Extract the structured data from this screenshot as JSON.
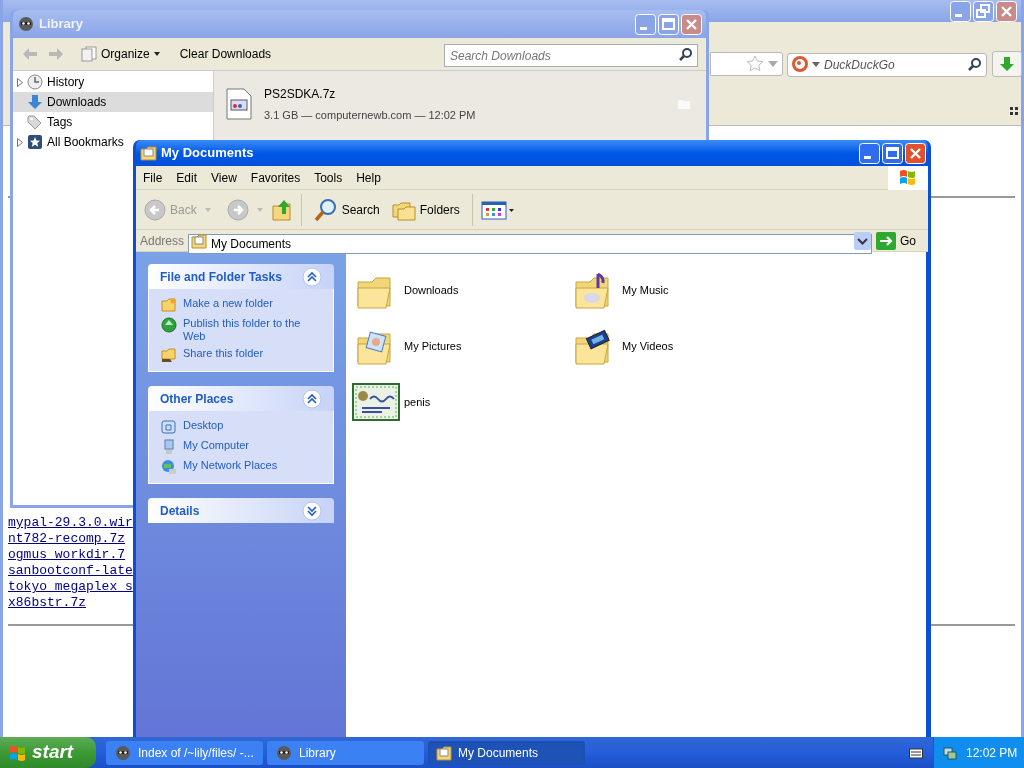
{
  "browser": {
    "search": {
      "placeholder": "DuckDuckGo"
    },
    "links": [
      "mypal-29.3.0.wir",
      "nt782-recomp.7z",
      "ogmus workdir.7",
      "sanbootconf-late",
      "tokyo megaplex s",
      "x86bstr.7z"
    ]
  },
  "library": {
    "title": "Library",
    "toolbar": {
      "organize": "Organize",
      "clear": "Clear Downloads",
      "search": {
        "placeholder": "Search Downloads"
      }
    },
    "sidebar": [
      {
        "label": "History",
        "kind": "history",
        "expandable": true,
        "selected": false
      },
      {
        "label": "Downloads",
        "kind": "downloads",
        "expandable": false,
        "selected": true
      },
      {
        "label": "Tags",
        "kind": "tags",
        "expandable": false,
        "selected": false
      },
      {
        "label": "All Bookmarks",
        "kind": "bookmarks",
        "expandable": true,
        "selected": false
      }
    ],
    "downloads": [
      {
        "name": "PS2SDKA.7z",
        "details": "3.1 GB — computernewb.com — 12:02 PM"
      }
    ]
  },
  "explorer": {
    "title": "My Documents",
    "menu": [
      "File",
      "Edit",
      "View",
      "Favorites",
      "Tools",
      "Help"
    ],
    "toolbar": {
      "back": "Back",
      "search": "Search",
      "folders": "Folders"
    },
    "address": {
      "label": "Address",
      "value": "My Documents",
      "go": "Go"
    },
    "panels": [
      {
        "title": "File and Folder Tasks",
        "expanded": true,
        "items": [
          {
            "label": "Make a new folder",
            "kind": "new-folder"
          },
          {
            "label": "Publish this folder to the Web",
            "kind": "publish"
          },
          {
            "label": "Share this folder",
            "kind": "share"
          }
        ]
      },
      {
        "title": "Other Places",
        "expanded": true,
        "items": [
          {
            "label": "Desktop",
            "kind": "desktop"
          },
          {
            "label": "My Computer",
            "kind": "computer"
          },
          {
            "label": "My Network Places",
            "kind": "network"
          }
        ]
      },
      {
        "title": "Details",
        "expanded": false
      }
    ],
    "items": [
      {
        "name": "Downloads",
        "kind": "folder"
      },
      {
        "name": "My Music",
        "kind": "music"
      },
      {
        "name": "My Pictures",
        "kind": "pictures"
      },
      {
        "name": "My Videos",
        "kind": "videos"
      },
      {
        "name": "penis",
        "kind": "certificate"
      }
    ]
  },
  "taskbar": {
    "start": "start",
    "tasks": [
      {
        "label": "Index of /~lily/files/ -...",
        "kind": "browser",
        "selected": false
      },
      {
        "label": "Library",
        "kind": "browser",
        "selected": false
      },
      {
        "label": "My Documents",
        "kind": "explorer",
        "selected": true
      }
    ],
    "clock": "12:02 PM"
  }
}
